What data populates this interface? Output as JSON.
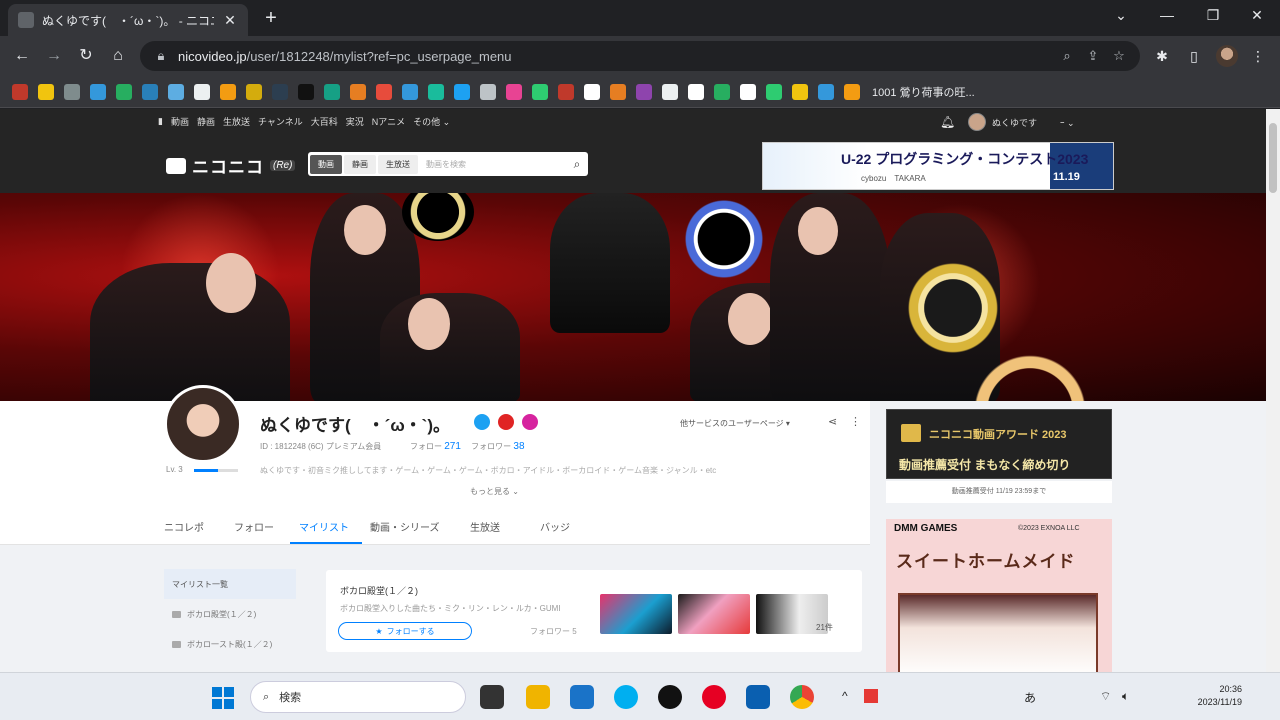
{
  "browser": {
    "tab_title": "ぬくゆです(　・´ω・`)。 - ニコニコ",
    "url_host": "nicovideo.jp",
    "url_path": "/user/1812248/mylist?ref=pc_userpage_menu",
    "bookmark_label": "1001 鶯り荷事の旺..."
  },
  "header": {
    "topnav": [
      "動画",
      "静画",
      "生放送",
      "チャンネル",
      "大百科",
      "実況",
      "Nアニメ",
      "その他 ⌄"
    ],
    "username": "ぬくゆです",
    "points": "ｰ ⌄",
    "logo_text": "ニコニコ",
    "logo_badge": "(Re)",
    "search_tabs": [
      "動画",
      "静画",
      "生放送"
    ],
    "search_placeholder": "動画を検索",
    "ad_title": "U-22 プログラミング・コンテスト2023",
    "ad_sub": "cybozu　TAKARA",
    "ad_date": "11.19"
  },
  "profile": {
    "display_name": "ぬくゆです(　・´ω・`)。",
    "user_id": "ID : 1812248 (6C) プレミアム会員",
    "follow_label": "フォロー",
    "follow_count": "271",
    "follower_label": "フォロワー",
    "follower_count": "38",
    "level": "Lv. 3",
    "description": "ぬくゆです・初音ミク推ししてます・ゲーム・ゲーム・ゲーム・ボカロ・アイドル・ボーカロイド・ゲーム音楽・ジャンル・etc",
    "show_more": "もっと見る ⌄",
    "other_services": "他サービスのユーザーページ ▾"
  },
  "tabs": [
    "ニコレポ",
    "フォロー",
    "マイリスト",
    "動画・シリーズ",
    "生放送",
    "バッジ"
  ],
  "mylist": {
    "sidebar": [
      "マイリスト一覧",
      "ボカロ殿堂(１／２)",
      "ボカロ一スト殿(１／２)"
    ],
    "card_title": "ボカロ殿堂(１／２)",
    "card_desc": "ボカロ殿堂入りした曲たち・ミク・リン・レン・ルカ・GUMI",
    "follow_button": "フォローする",
    "followers": "フォロワー 5",
    "count": "21件"
  },
  "right": {
    "award_title": "ニコニコ動画アワード 2023",
    "award_sub": "動画推薦受付 まもなく締め切り",
    "award_foot": "動画推薦受付 11/19 23:59まで",
    "dmm_head": "DMM GAMES",
    "dmm_copy": "©2023 EXNOA LLC",
    "dmm_title": "スイートホームメイド"
  },
  "taskbar": {
    "search_label": "検索",
    "tray_lang": "あ",
    "time": "20:36",
    "date": "2023/11/19"
  },
  "colors": {
    "accent": "#0080ff",
    "header_bg": "#252525"
  }
}
